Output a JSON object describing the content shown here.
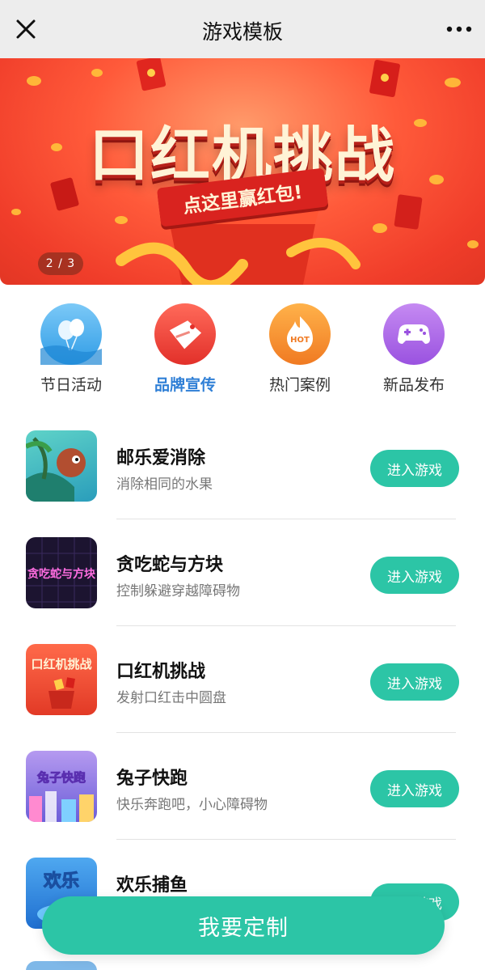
{
  "navbar": {
    "title": "游戏模板",
    "close_icon": "close-icon",
    "more_icon": "more-icon"
  },
  "banner": {
    "title": "口红机挑战",
    "ribbon": "点这里赢红包!",
    "pager": "2 / 3"
  },
  "categories": [
    {
      "label": "节日活动",
      "icon": "balloon-icon",
      "color": "#2f9ce6",
      "active": false
    },
    {
      "label": "品牌宣传",
      "icon": "tag-icon",
      "color": "#ee3b33",
      "active": true
    },
    {
      "label": "热门案例",
      "icon": "hot-flame-icon",
      "color": "#f58a2c",
      "active": false
    },
    {
      "label": "新品发布",
      "icon": "gamepad-icon",
      "color": "#a660e8",
      "active": false
    }
  ],
  "games": [
    {
      "name": "邮乐爱消除",
      "desc": "消除相同的水果",
      "button": "进入游戏"
    },
    {
      "name": "贪吃蛇与方块",
      "desc": "控制躲避穿越障碍物",
      "button": "进入游戏",
      "thumb_text": "贪吃蛇与方块"
    },
    {
      "name": "口红机挑战",
      "desc": "发射口红击中圆盘",
      "button": "进入游戏",
      "thumb_text": "口红机挑战"
    },
    {
      "name": "兔子快跑",
      "desc": "快乐奔跑吧，小心障碍物",
      "button": "进入游戏",
      "thumb_text": "兔子快跑"
    },
    {
      "name": "欢乐捕鱼",
      "desc": "",
      "button": "进入游戏",
      "thumb_text": "欢乐"
    }
  ],
  "cta": {
    "label": "我要定制"
  },
  "colors": {
    "accent": "#2cc5a6",
    "active_tab": "#2f7fd6",
    "navbar_bg": "#ededed"
  }
}
